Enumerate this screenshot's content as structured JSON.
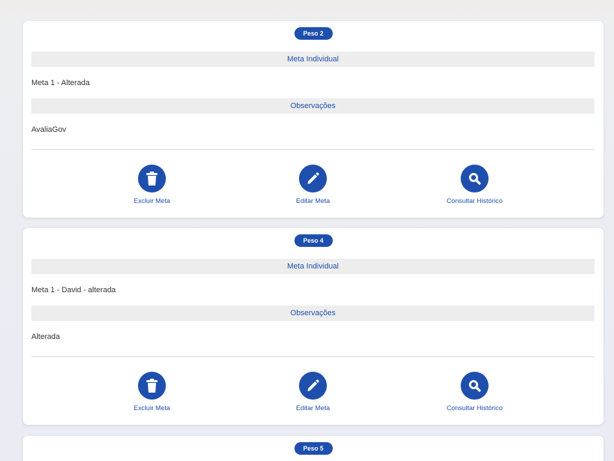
{
  "goals": [
    {
      "weight_label": "Peso 2",
      "meta_header": "Meta Individual",
      "meta_value": "Meta 1 - Alterada",
      "obs_header": "Observações",
      "obs_value": "AvaliaGov",
      "actions": {
        "delete_label": "Excluir Meta",
        "edit_label": "Editar Meta",
        "history_label": "Consultar Histórico"
      }
    },
    {
      "weight_label": "Peso 4",
      "meta_header": "Meta Individual",
      "meta_value": "Meta 1 - David - alterada",
      "obs_header": "Observações",
      "obs_value": "Alterada",
      "actions": {
        "delete_label": "Excluir Meta",
        "edit_label": "Editar Meta",
        "history_label": "Consultar Histórico"
      }
    },
    {
      "weight_label": "Peso 5"
    }
  ],
  "icons": {
    "delete": "trash-icon",
    "edit": "pencil-icon",
    "history": "search-icon"
  },
  "colors": {
    "accent": "#1f4fad",
    "section_bg": "#ededed"
  }
}
